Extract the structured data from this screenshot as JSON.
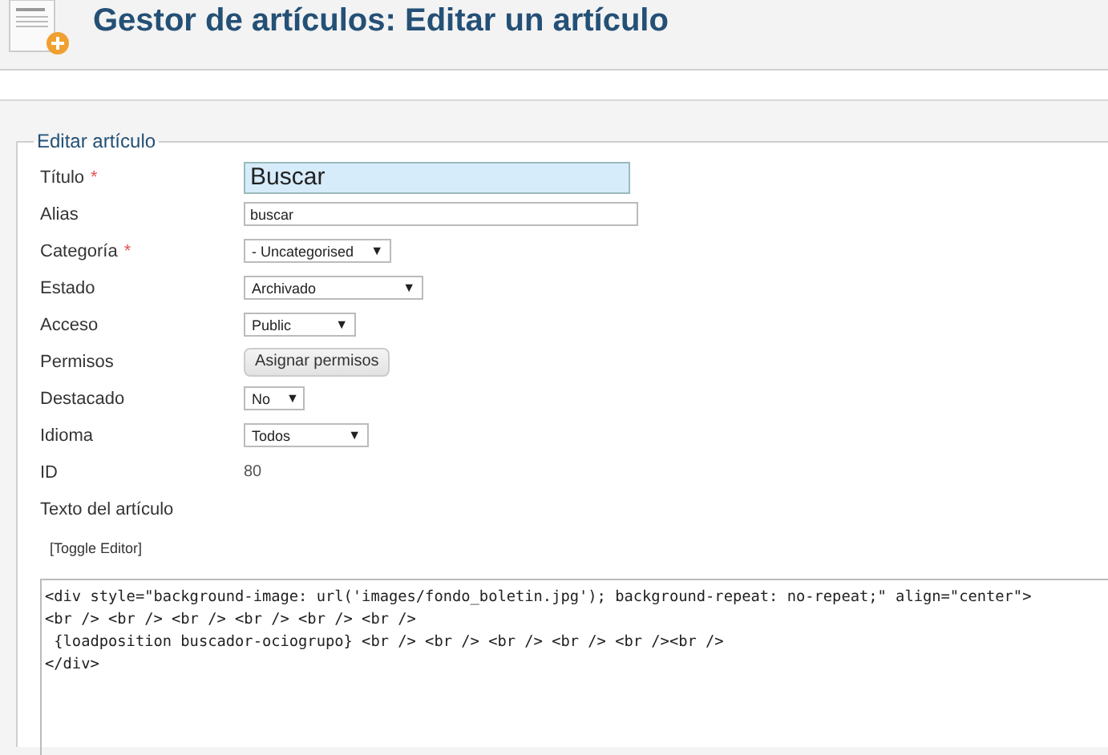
{
  "header": {
    "title": "Gestor de artículos: Editar un artículo"
  },
  "form": {
    "legend": "Editar artículo",
    "fields": [
      {
        "kind": "large-text",
        "label": "Título",
        "required_mark": "*",
        "value": "Buscar"
      },
      {
        "kind": "text",
        "label": "Alias",
        "value": "buscar"
      },
      {
        "kind": "select",
        "label": "Categoría",
        "required_mark": "*",
        "value": "- Uncategorised",
        "caret": "▼"
      },
      {
        "kind": "select",
        "label": "Estado",
        "value": "Archivado",
        "caret": "▼"
      },
      {
        "kind": "select",
        "label": "Acceso",
        "value": "Public",
        "caret": "▼"
      },
      {
        "kind": "button",
        "label": "Permisos",
        "value": "Asignar permisos"
      },
      {
        "kind": "select",
        "label": "Destacado",
        "value": "No",
        "caret": "▼"
      },
      {
        "kind": "select",
        "label": "Idioma",
        "value": "Todos",
        "caret": "▼"
      },
      {
        "kind": "static",
        "label": "ID",
        "value": "80"
      },
      {
        "kind": "label",
        "label": "Texto del artículo"
      }
    ],
    "toggle_editor": "[Toggle Editor]",
    "editor_lines": [
      "<div style=\"background-image: url('images/fondo_boletin.jpg'); background-repeat: no-repeat;\" align=\"center\">",
      "<br /> <br /> <br /> <br /> <br /> <br />",
      " {loadposition buscador-ociogrupo} <br /> <br /> <br /> <br /> <br /><br />",
      "</div>"
    ]
  }
}
